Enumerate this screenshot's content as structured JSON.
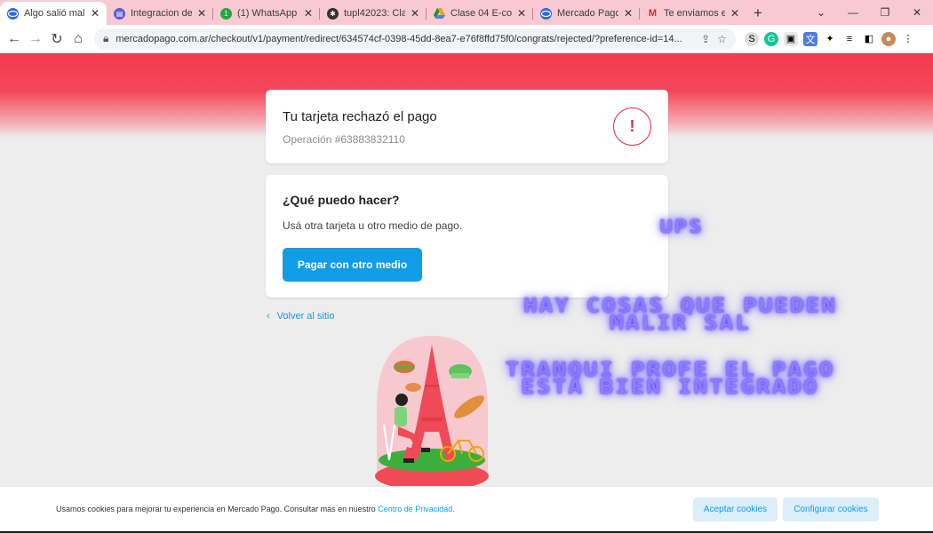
{
  "browser": {
    "tabs": [
      {
        "title": "Algo salió mal...",
        "favicon": "mercadopago-icon",
        "color": "#2f6ad8",
        "active": true
      },
      {
        "title": "Integracion de m",
        "favicon": "printer-icon",
        "color": "#5b5bd6",
        "active": false
      },
      {
        "title": "(1) WhatsApp",
        "favicon": "whatsapp-icon",
        "color": "#1faa3a",
        "active": false
      },
      {
        "title": "tupl42023: Clase",
        "favicon": "github-icon",
        "color": "#333333",
        "active": false
      },
      {
        "title": "Clase 04 E-comm",
        "favicon": "google-drive-icon",
        "color": "#f2a600",
        "active": false
      },
      {
        "title": "Mercado Pago D",
        "favicon": "mercadopago-icon",
        "color": "#2f6ad8",
        "active": false
      },
      {
        "title": "Te enviamos el c",
        "favicon": "gmail-icon",
        "color": "#d93025",
        "active": false
      }
    ],
    "new_tab": "+",
    "url": "mercadopago.com.ar/checkout/v1/payment/redirect/634574cf-0398-45dd-8ea7-e76f8ffd75f0/congrats/rejected/?preference-id=14..."
  },
  "status_card": {
    "title": "Tu tarjeta rechazó el pago",
    "operation": "Operación #63883832110",
    "alert_glyph": "!"
  },
  "action_card": {
    "title": "¿Qué puedo hacer?",
    "description": "Usá otra tarjeta u otro medio de pago.",
    "button": "Pagar con otro medio"
  },
  "back_link": "Volver al sitio",
  "overlay": {
    "line1": "UPS",
    "line2a": "HAY COSAS QUE PUEDEN",
    "line2b": "MALIR SAL",
    "line3a": "TRANQUI PROFE EL PAGO",
    "line3b": "ESTA BIEN INTEGRADO"
  },
  "cookie_banner": {
    "message": "Usamos cookies para mejorar tu experiencia en Mercado Pago. Consultar más en nuestro",
    "link": "Centro de Privacidad.",
    "accept": "Aceptar cookies",
    "configure": "Configurar cookies"
  },
  "colors": {
    "brand_blue": "#119de6",
    "error_red": "#e2293f",
    "header_red": "#f43a4e"
  }
}
